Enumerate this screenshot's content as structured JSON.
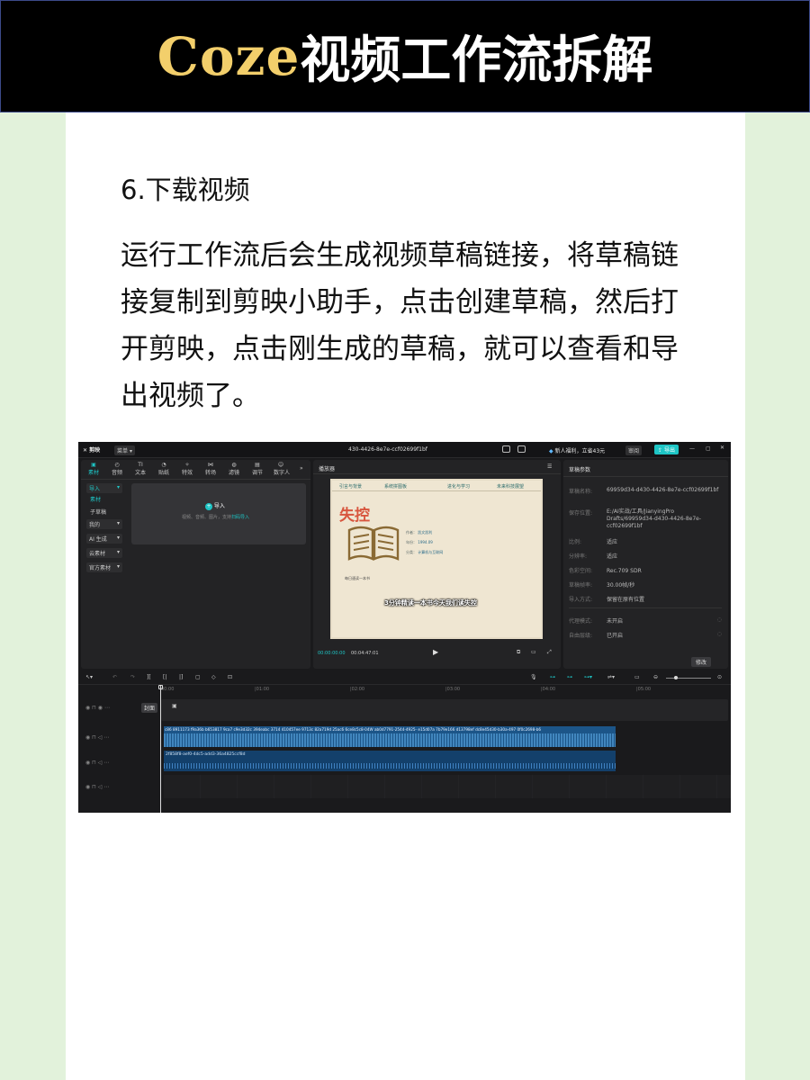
{
  "header": {
    "title_en": "Coze",
    "title_cn": "视频工作流拆解"
  },
  "step": {
    "title": "6.下载视频"
  },
  "body_text": "运行工作流后会生成视频草稿链接，将草稿链接复制到剪映小助手，点击创建草稿，然后打开剪映，点击刚生成的草稿，就可以查看和导出视频了。",
  "editor": {
    "app_name": "剪映",
    "menu_label": "菜单",
    "project_title": "430-4426-8e7e-ccf02699f1bf",
    "promo": "新人福利，立省43元",
    "review_label": "审阅",
    "export_label": "导出",
    "tools": [
      "素材",
      "音频",
      "文本",
      "贴纸",
      "特效",
      "转场",
      "滤镜",
      "调节",
      "数字人"
    ],
    "left_menu": [
      "导入",
      "素材",
      "子草稿",
      "我的",
      "AI 生成",
      "云素材",
      "官方素材"
    ],
    "import_title": "导入",
    "import_sub": "视频、音频、图片，支持",
    "import_link": "扫码导入",
    "player_title": "播放器",
    "book_tabs": [
      "引言与背景",
      "系统拼图板",
      "进化与学习",
      "未来科技展望"
    ],
    "book_title": "失控",
    "book_info": [
      "作者：",
      "凯文凯利",
      "年份：",
      "1994.09",
      "分类：",
      "计算机与互联网"
    ],
    "daily_read": "每日速读一本书",
    "subtitle": "3分钟精读一本书今天我们读失控",
    "time_current": "00:00:00:00",
    "time_total": "00:04:47:01",
    "draft_params_title": "草稿参数",
    "params": [
      {
        "k": "草稿名称:",
        "v": "69959d34-d430-4426-8e7e-ccf02699f1bf"
      },
      {
        "k": "保存位置:",
        "v": "E:/AI实战/工具/JianyingPro Drafts/69959d34-d430-4426-8e7e-ccf02699f1bf"
      },
      {
        "k": "比例:",
        "v": "适应"
      },
      {
        "k": "分辨率:",
        "v": "适应"
      },
      {
        "k": "色彩空间:",
        "v": "Rec.709 SDR"
      },
      {
        "k": "草稿帧率:",
        "v": "30.00帧/秒"
      },
      {
        "k": "导入方式:",
        "v": "保留在原有位置"
      },
      {
        "k": "代理模式:",
        "v": "未开启"
      },
      {
        "k": "自由层级:",
        "v": "已开启"
      }
    ],
    "modify_label": "修改",
    "cover_label": "封面",
    "clip_labels": "c86 8911173 f9a36b b653817 9ca7 c9e3d32c 394eabc 3714 410457ee 9713c 82a719d 25ac6 6ce8c5c8-04W ab0d7791-2544-4925- e15d07a 7b79e166 d13798ef dc8e45d30-b30a-497 0f0c2698-b6",
    "audio_label": "2f858f8-aef0-4dc5-add3-36a4825ccf8d",
    "ruler_marks": [
      "00:00",
      "|01:00",
      "|02:00",
      "|03:00",
      "|04:00",
      "|05:00"
    ]
  },
  "colors": {
    "accent": "#1ec5c5",
    "title_gold": "#f3cf6b",
    "book_red": "#d8563e",
    "clip_blue": "#1f5f96"
  }
}
